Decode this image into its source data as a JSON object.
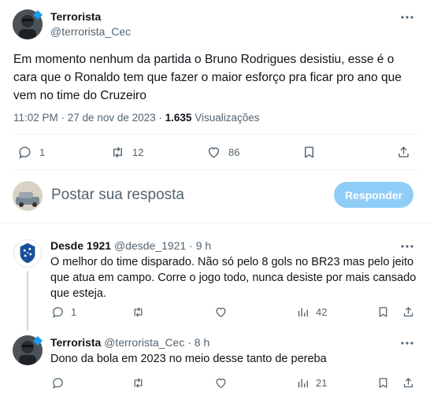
{
  "tweet": {
    "author_name": "Terrorista",
    "author_handle": "@terrorista_Cec",
    "text_line1": "Em momento nenhum da partida o Bruno Rodrigues desistiu, esse é o",
    "text_line2": "cara que o Ronaldo tem que fazer o maior esforço pra ficar pro ano que",
    "text_line3": "vem no time do Cruzeiro",
    "time": "11:02 PM · 27 de nov de 2023 · ",
    "views_count": "1.635",
    "views_label": " Visualizações",
    "replies": "1",
    "retweets": "12",
    "likes": "86"
  },
  "composer": {
    "placeholder": "Postar sua resposta",
    "button_label": "Responder",
    "button_color": "#8ecdf8"
  },
  "replies": [
    {
      "author_name": "Desde 1921",
      "author_handle": "@desde_1921",
      "time": "· 9 h",
      "text_line1": "O melhor do time disparado. Não só pelo 8 gols no BR23 mas pelo jeito",
      "text_line2": "que atua em campo. Corre o jogo todo, nunca desiste por mais cansado",
      "text_line3": "que esteja.",
      "replies": "1",
      "views": "42"
    },
    {
      "author_name": "Terrorista",
      "author_handle": "@terrorista_Cec",
      "time": "· 8 h",
      "text_line1": "Dono da bola em 2023 no meio desse tanto de pereba",
      "views": "21"
    }
  ],
  "colors": {
    "text": "#0f1419",
    "muted": "#536471",
    "accent": "#1d9bf0"
  }
}
